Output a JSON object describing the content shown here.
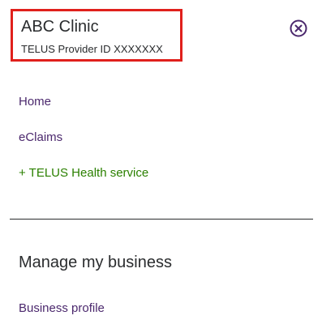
{
  "account": {
    "clinic_name": "ABC Clinic",
    "provider_id": "TELUS Provider ID XXXXXXX"
  },
  "close": {
    "icon": "close-circle-icon",
    "color": "#4b286d"
  },
  "nav": {
    "home": "Home",
    "eclaims": "eClaims",
    "add_service": "+ TELUS Health service"
  },
  "manage": {
    "heading": "Manage my business",
    "business_profile": "Business profile"
  },
  "colors": {
    "link_purple": "#4b286d",
    "link_green": "#2b8000",
    "highlight_red": "#e0201c",
    "text_dark": "#2a2c2e"
  }
}
